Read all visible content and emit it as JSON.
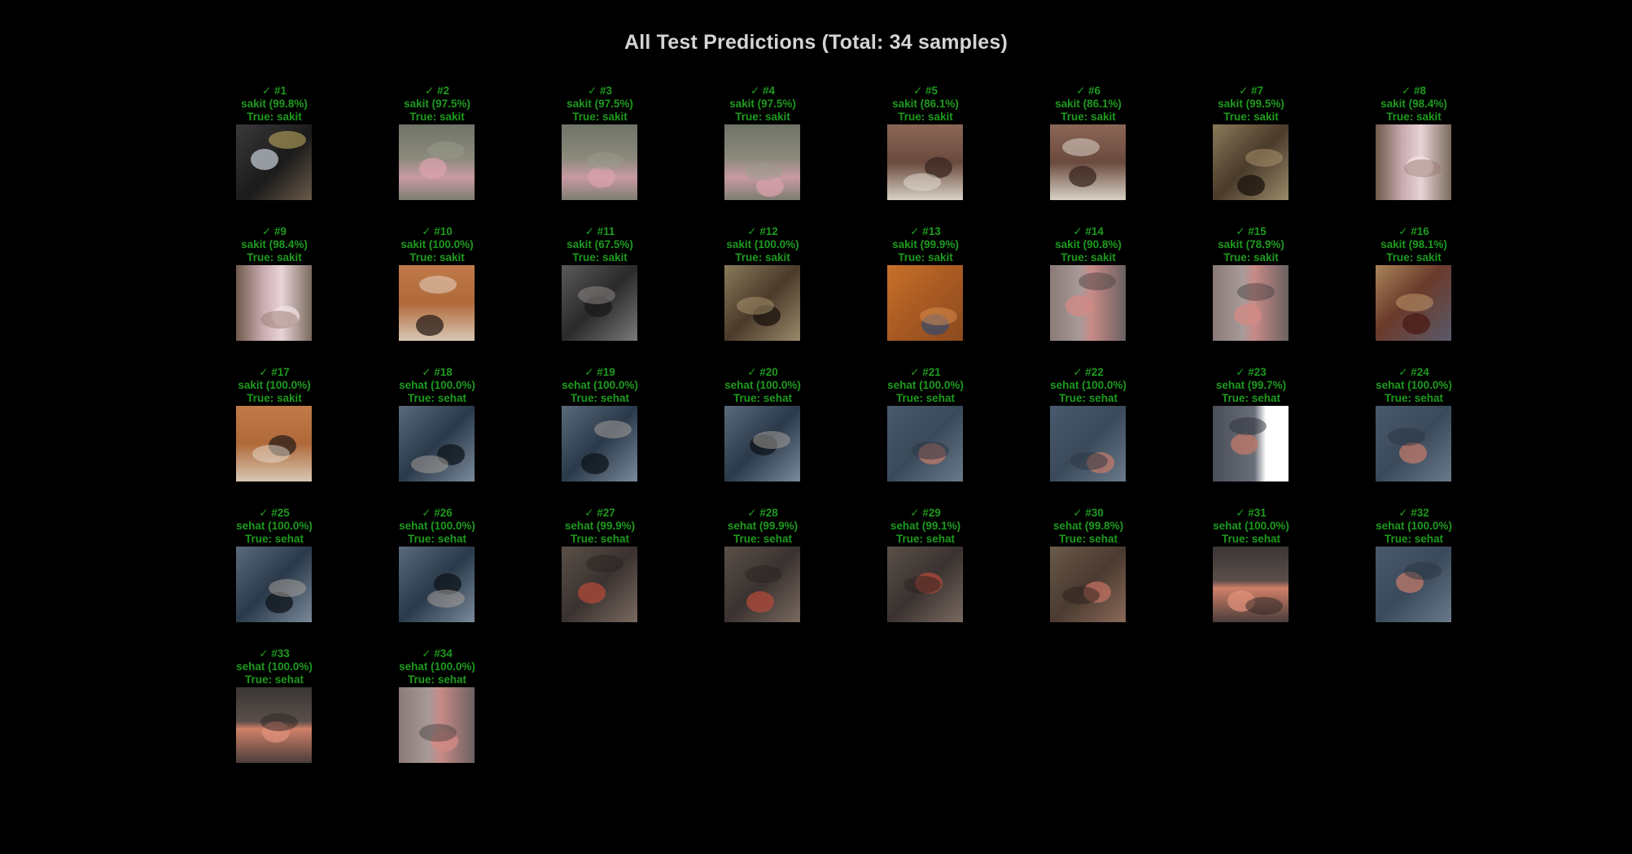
{
  "title": "All Test Predictions (Total: 34 samples)",
  "colors": {
    "background": "#000000",
    "title": "#d4d4d4",
    "correct": "#1e9a1e"
  },
  "grid": {
    "columns": 8
  },
  "samples": [
    {
      "mark": "✓",
      "id": "#1",
      "pred": "sakit (99.8%)",
      "true": "True: sakit",
      "tone": "dark-cow-face"
    },
    {
      "mark": "✓",
      "id": "#2",
      "pred": "sakit (97.5%)",
      "true": "True: sakit",
      "tone": "pink-lip"
    },
    {
      "mark": "✓",
      "id": "#3",
      "pred": "sakit (97.5%)",
      "true": "True: sakit",
      "tone": "pink-lip"
    },
    {
      "mark": "✓",
      "id": "#4",
      "pred": "sakit (97.5%)",
      "true": "True: sakit",
      "tone": "pink-lip"
    },
    {
      "mark": "✓",
      "id": "#5",
      "pred": "sakit (86.1%)",
      "true": "True: sakit",
      "tone": "brown-mouth"
    },
    {
      "mark": "✓",
      "id": "#6",
      "pred": "sakit (86.1%)",
      "true": "True: sakit",
      "tone": "brown-mouth"
    },
    {
      "mark": "✓",
      "id": "#7",
      "pred": "sakit (99.5%)",
      "true": "True: sakit",
      "tone": "dark-eye"
    },
    {
      "mark": "✓",
      "id": "#8",
      "pred": "sakit (98.4%)",
      "true": "True: sakit",
      "tone": "pink-gum"
    },
    {
      "mark": "✓",
      "id": "#9",
      "pred": "sakit (98.4%)",
      "true": "True: sakit",
      "tone": "pink-gum"
    },
    {
      "mark": "✓",
      "id": "#10",
      "pred": "sakit (100.0%)",
      "true": "True: sakit",
      "tone": "tan-cow-face"
    },
    {
      "mark": "✓",
      "id": "#11",
      "pred": "sakit (67.5%)",
      "true": "True: sakit",
      "tone": "dark-grey-face"
    },
    {
      "mark": "✓",
      "id": "#12",
      "pred": "sakit (100.0%)",
      "true": "True: sakit",
      "tone": "dark-eye"
    },
    {
      "mark": "✓",
      "id": "#13",
      "pred": "sakit (99.9%)",
      "true": "True: sakit",
      "tone": "orange-hide"
    },
    {
      "mark": "✓",
      "id": "#14",
      "pred": "sakit (90.8%)",
      "true": "True: sakit",
      "tone": "grey-nose"
    },
    {
      "mark": "✓",
      "id": "#15",
      "pred": "sakit (78.9%)",
      "true": "True: sakit",
      "tone": "grey-nose"
    },
    {
      "mark": "✓",
      "id": "#16",
      "pred": "sakit (98.1%)",
      "true": "True: sakit",
      "tone": "brown-lesion"
    },
    {
      "mark": "✓",
      "id": "#17",
      "pred": "sakit (100.0%)",
      "true": "True: sakit",
      "tone": "tan-cow-face"
    },
    {
      "mark": "✓",
      "id": "#18",
      "pred": "sehat (100.0%)",
      "true": "True: sehat",
      "tone": "blue-nose"
    },
    {
      "mark": "✓",
      "id": "#19",
      "pred": "sehat (100.0%)",
      "true": "True: sehat",
      "tone": "blue-nose"
    },
    {
      "mark": "✓",
      "id": "#20",
      "pred": "sehat (100.0%)",
      "true": "True: sehat",
      "tone": "blue-nose"
    },
    {
      "mark": "✓",
      "id": "#21",
      "pred": "sehat (100.0%)",
      "true": "True: sehat",
      "tone": "slate-texture"
    },
    {
      "mark": "✓",
      "id": "#22",
      "pred": "sehat (100.0%)",
      "true": "True: sehat",
      "tone": "slate-texture"
    },
    {
      "mark": "✓",
      "id": "#23",
      "pred": "sehat (99.7%)",
      "true": "True: sehat",
      "tone": "slate-white"
    },
    {
      "mark": "✓",
      "id": "#24",
      "pred": "sehat (100.0%)",
      "true": "True: sehat",
      "tone": "slate-texture"
    },
    {
      "mark": "✓",
      "id": "#25",
      "pred": "sehat (100.0%)",
      "true": "True: sehat",
      "tone": "blue-nose"
    },
    {
      "mark": "✓",
      "id": "#26",
      "pred": "sehat (100.0%)",
      "true": "True: sehat",
      "tone": "blue-nose"
    },
    {
      "mark": "✓",
      "id": "#27",
      "pred": "sehat (99.9%)",
      "true": "True: sehat",
      "tone": "dark-texture"
    },
    {
      "mark": "✓",
      "id": "#28",
      "pred": "sehat (99.9%)",
      "true": "True: sehat",
      "tone": "dark-texture"
    },
    {
      "mark": "✓",
      "id": "#29",
      "pred": "sehat (99.1%)",
      "true": "True: sehat",
      "tone": "dark-texture"
    },
    {
      "mark": "✓",
      "id": "#30",
      "pred": "sehat (99.8%)",
      "true": "True: sehat",
      "tone": "brown-nostril"
    },
    {
      "mark": "✓",
      "id": "#31",
      "pred": "sehat (100.0%)",
      "true": "True: sehat",
      "tone": "dark-pink-lip"
    },
    {
      "mark": "✓",
      "id": "#32",
      "pred": "sehat (100.0%)",
      "true": "True: sehat",
      "tone": "slate-texture"
    },
    {
      "mark": "✓",
      "id": "#33",
      "pred": "sehat (100.0%)",
      "true": "True: sehat",
      "tone": "dark-pink-lip"
    },
    {
      "mark": "✓",
      "id": "#34",
      "pred": "sehat (100.0%)",
      "true": "True: sehat",
      "tone": "grey-nose"
    }
  ]
}
